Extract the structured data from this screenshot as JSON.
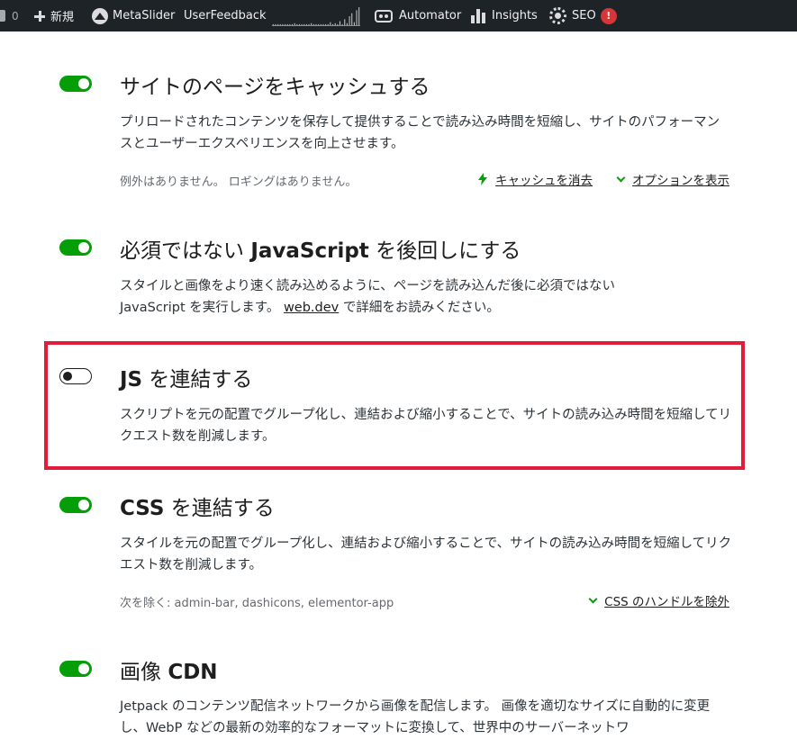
{
  "adminbar": {
    "comments_count": "0",
    "new_label": "新規",
    "metaslider_label": "MetaSlider",
    "userfeedback_label": "UserFeedback",
    "automator_label": "Automator",
    "insights_label": "Insights",
    "seo_label": "SEO",
    "seo_alert": "!",
    "sparkline": [
      1,
      1,
      1,
      1,
      1,
      1,
      1,
      1,
      1,
      2,
      1,
      1,
      1,
      1,
      1,
      1,
      2,
      1,
      1,
      1,
      1,
      1,
      1,
      1,
      3,
      1,
      2,
      1,
      4,
      1,
      6,
      2,
      9,
      12,
      3,
      15,
      18
    ]
  },
  "settings": [
    {
      "title": "サイトのページをキャッシュする",
      "enabled": true,
      "description": "プリロードされたコンテンツを保存して提供することで読み込み時間を短縮し、サイトのパフォーマンスとユーザーエクスペリエンスを向上させます。",
      "meta": "例外はありません。 ロギングはありません。",
      "actions": [
        {
          "label": "キャッシュを消去",
          "icon": "bolt-icon"
        },
        {
          "label": "オプションを表示",
          "icon": "chevron-down-icon"
        }
      ]
    },
    {
      "title_prefix": "必須ではない ",
      "title_bold": "JavaScript",
      "title_suffix": " を後回しにする",
      "enabled": true,
      "description_line1": "スタイルと画像をより速く読み込めるように、ページを読み込んだ後に必須ではない",
      "description_line2_prefix": "JavaScript を実行します。 ",
      "description_link": "web.dev",
      "description_line2_suffix": " で詳細をお読みください。"
    },
    {
      "title_bold": "JS",
      "title_suffix": " を連結する",
      "enabled": false,
      "description": "スクリプトを元の配置でグループ化し、連結および縮小することで、サイトの読み込み時間を短縮してリクエスト数を削減します。"
    },
    {
      "title_bold": "CSS",
      "title_suffix": " を連結する",
      "enabled": true,
      "description": "スタイルを元の配置でグループ化し、連結および縮小することで、サイトの読み込み時間を短縮してリクエスト数を削減します。",
      "meta": "次を除く: admin-bar, dashicons, elementor-app",
      "actions": [
        {
          "label": "CSS のハンドルを除外",
          "icon": "chevron-down-icon"
        }
      ]
    },
    {
      "title_prefix": "画像 ",
      "title_bold": "CDN",
      "enabled": true,
      "description": "Jetpack のコンテンツ配信ネットワークから画像を配信します。 画像を適切なサイズに自動的に変更し、WebP などの最新の効率的なフォーマットに変換して、世界中のサーバーネットワ"
    }
  ],
  "colors": {
    "toggle_on": "#069e08",
    "highlight_border": "#e21d3c",
    "adminbar_bg": "#1d2327",
    "alert_red": "#d63638"
  }
}
